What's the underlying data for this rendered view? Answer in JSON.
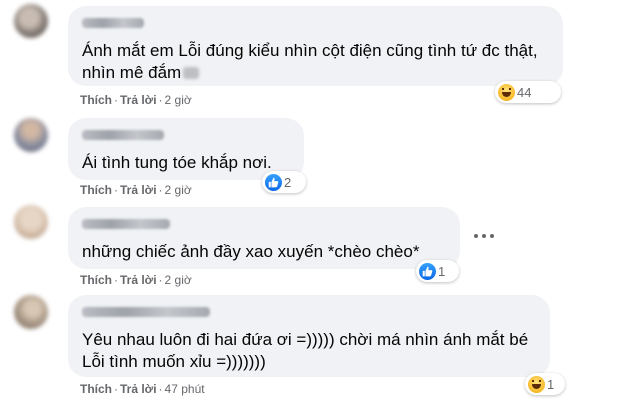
{
  "comments": [
    {
      "text": "Ánh mắt em Lỗi đúng kiểu nhìn cột điện cũng tình tứ đc thật, nhìn mê đắm",
      "like_label": "Thích",
      "reply_label": "Trả lời",
      "time": "2 giờ",
      "reaction": {
        "icon": "haha-icon",
        "count": "44"
      }
    },
    {
      "text": "Ái tình tung tóe khắp nơi.",
      "like_label": "Thích",
      "reply_label": "Trả lời",
      "time": "2 giờ",
      "reaction": {
        "icon": "like-icon",
        "count": "2"
      }
    },
    {
      "text": "những chiếc ảnh đầy xao xuyến *chèo chèo*",
      "like_label": "Thích",
      "reply_label": "Trả lời",
      "time": "2 giờ",
      "reaction": {
        "icon": "like-icon",
        "count": "1"
      },
      "more_icon": "more-options-icon"
    },
    {
      "text": "Yêu nhau luôn đi hai đứa ơi =))))) chời má nhìn ánh mắt bé Lỗi tình muốn xỉu =)))))))",
      "like_label": "Thích",
      "reply_label": "Trả lời",
      "time": "47 phút",
      "reaction": {
        "icon": "haha-icon",
        "count": "1"
      }
    }
  ],
  "colors": {
    "bubble": "#f0f2f5",
    "meta_text": "#65676b",
    "like_blue": "#1877f2",
    "haha_yellow": "#f7b928"
  }
}
